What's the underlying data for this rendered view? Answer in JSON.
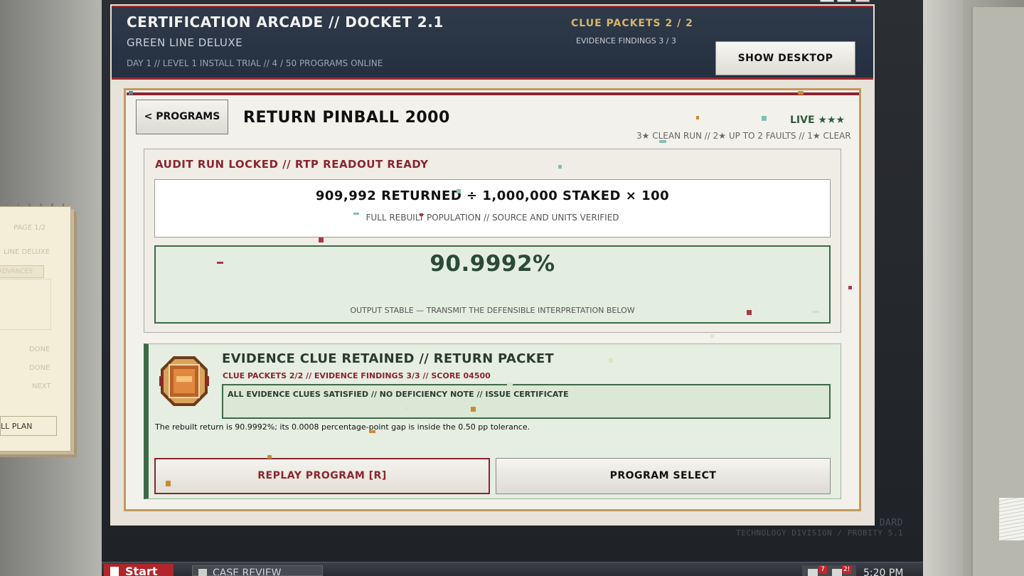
{
  "header": {
    "title": "CERTIFICATION ARCADE // DOCKET 2.1",
    "subtitle": "GREEN LINE DELUXE",
    "meta": "DAY 1 // LEVEL 1 INSTALL TRIAL // 4 / 50 PROGRAMS ONLINE",
    "clue_packets": "CLUE PACKETS 2 / 2",
    "evidence_findings": "EVIDENCE FINDINGS 3 / 3",
    "show_desktop_label": "SHOW DESKTOP"
  },
  "game": {
    "back_label": "< PROGRAMS",
    "title": "RETURN PINBALL 2000",
    "live_label": "LIVE ★★★",
    "rating_rule": "3★ CLEAN RUN  //  2★ UP TO 2 FAULTS  //  1★ CLEAR"
  },
  "audit": {
    "heading": "AUDIT RUN LOCKED // RTP READOUT READY",
    "formula": "909,992 RETURNED  ÷  1,000,000 STAKED  ×  100",
    "formula_sub": "FULL REBUILT POPULATION // SOURCE AND UNITS VERIFIED",
    "readout": "90.9992%",
    "readout_sub": "OUTPUT STABLE — TRANSMIT THE DEFENSIBLE INTERPRETATION BELOW"
  },
  "evidence": {
    "title": "EVIDENCE CLUE RETAINED // RETURN PACKET",
    "stats": "CLUE PACKETS 2/2 // EVIDENCE FINDINGS 3/3 // SCORE 04500",
    "note": "ALL EVIDENCE CLUES SATISFIED // NO DEFICIENCY NOTE // ISSUE CERTIFICATE",
    "text": "The rebuilt return is 90.9992%; its 0.0008 percentage-point gap is inside the 0.50 pp tolerance.",
    "replay_label": "REPLAY PROGRAM  [R]",
    "select_label": "PROGRAM SELECT",
    "badge_icon": "evidence-badge-icon"
  },
  "notebook": {
    "page": "PAGE 1/2",
    "line": "LINE DELUXE",
    "advances": "ADVANCES",
    "done1": "DONE",
    "done2": "DONE",
    "next": "NEXT",
    "plan": "LL PLAN"
  },
  "monitor": {
    "brand": "DARD",
    "division": "TECHNOLOGY DIVISION  /  PROBITY 5.1"
  },
  "taskbar": {
    "start_label": "Start",
    "case_review_label": "CASE REVIEW",
    "badge_1": "7",
    "badge_2": "2!",
    "clock": "5:20 PM"
  },
  "colors": {
    "accent_red": "#8a2530",
    "accent_green": "#3c6a48",
    "header_bg": "#2f3a4a",
    "frame_gold": "#c19a5f"
  }
}
